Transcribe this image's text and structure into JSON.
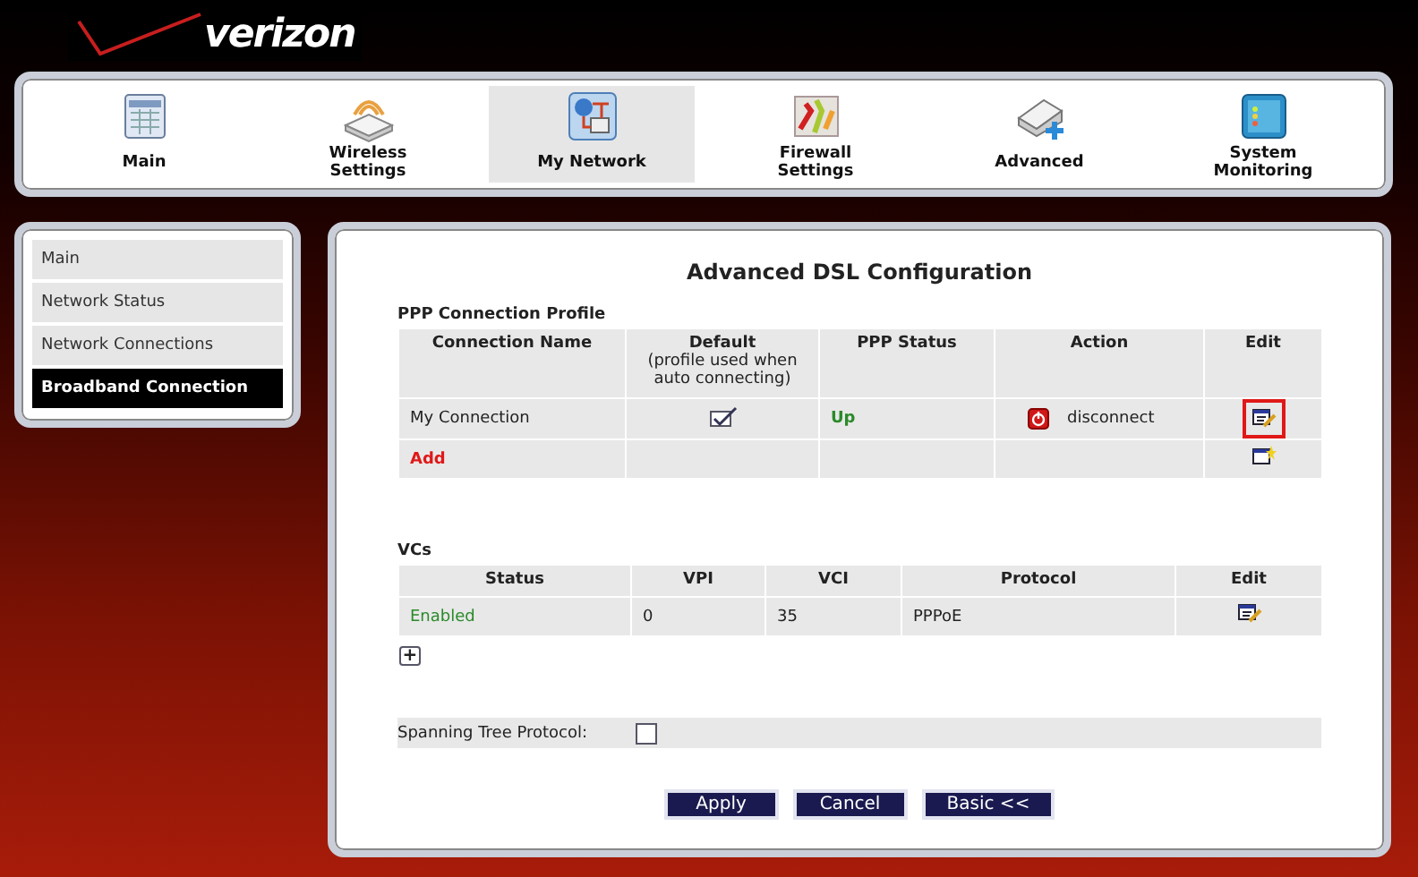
{
  "logo": {
    "text": "verizon"
  },
  "nav": [
    {
      "label": "Main",
      "selected": false
    },
    {
      "label": "Wireless\nSettings",
      "selected": false
    },
    {
      "label": "My Network",
      "selected": true
    },
    {
      "label": "Firewall\nSettings",
      "selected": false
    },
    {
      "label": "Advanced",
      "selected": false
    },
    {
      "label": "System\nMonitoring",
      "selected": false
    }
  ],
  "sidebar": {
    "items": [
      {
        "label": "Main",
        "selected": false
      },
      {
        "label": "Network Status",
        "selected": false
      },
      {
        "label": "Network Connections",
        "selected": false
      },
      {
        "label": "Broadband Connection",
        "selected": true
      }
    ]
  },
  "main": {
    "title": "Advanced DSL Configuration",
    "ppp": {
      "title": "PPP Connection Profile",
      "columns": [
        {
          "label": "Connection Name"
        },
        {
          "label": "Default",
          "note": "(profile used when auto connecting)"
        },
        {
          "label": "PPP Status"
        },
        {
          "label": "Action"
        },
        {
          "label": "Edit"
        }
      ],
      "rows": [
        {
          "kind": "connection",
          "name": "My Connection",
          "default": true,
          "status": "Up",
          "action": "disconnect",
          "highlighted": true
        },
        {
          "kind": "add",
          "name": "Add",
          "highlighted": false
        }
      ]
    },
    "vcs": {
      "title": "VCs",
      "columns": [
        "Status",
        "VPI",
        "VCI",
        "Protocol",
        "Edit"
      ],
      "rows": [
        {
          "status": "Enabled",
          "vpi": "0",
          "vci": "35",
          "protocol": "PPPoE"
        }
      ],
      "add_button": "+"
    },
    "spanning_tree": {
      "label": "Spanning Tree Protocol:",
      "checked": false
    },
    "buttons": [
      "Apply",
      "Cancel",
      "Basic <<"
    ]
  }
}
